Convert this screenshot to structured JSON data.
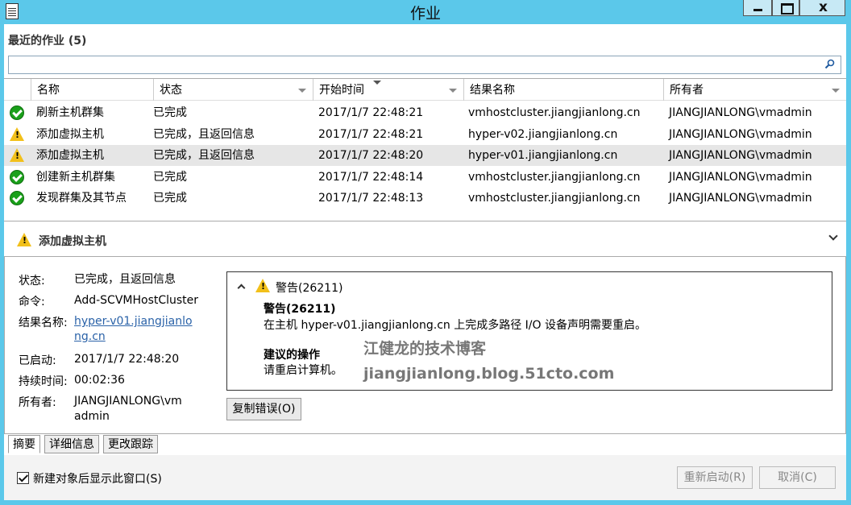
{
  "window": {
    "title": "作业",
    "close_glyph": "x"
  },
  "recent": {
    "title": "最近的作业 (5)",
    "search_placeholder": ""
  },
  "columns": [
    {
      "label": "名称"
    },
    {
      "label": "状态"
    },
    {
      "label": "开始时间"
    },
    {
      "label": "结果名称"
    },
    {
      "label": "所有者"
    }
  ],
  "jobs": [
    {
      "icon": "success-icon",
      "name": "刷新主机群集",
      "status": "已完成",
      "start": "2017/1/7 22:48:21",
      "result": "vmhostcluster.jiangjianlong.cn",
      "owner": "JIANGJIANLONG\\vmadmin"
    },
    {
      "icon": "warning-icon",
      "name": "添加虚拟主机",
      "status": "已完成，且返回信息",
      "start": "2017/1/7 22:48:21",
      "result": "hyper-v02.jiangjianlong.cn",
      "owner": "JIANGJIANLONG\\vmadmin"
    },
    {
      "icon": "warning-icon",
      "name": "添加虚拟主机",
      "status": "已完成，且返回信息",
      "start": "2017/1/7 22:48:20",
      "result": "hyper-v01.jiangjianlong.cn",
      "owner": "JIANGJIANLONG\\vmadmin",
      "selected": true
    },
    {
      "icon": "success-icon",
      "name": "创建新主机群集",
      "status": "已完成",
      "start": "2017/1/7 22:48:14",
      "result": "vmhostcluster.jiangjianlong.cn",
      "owner": "JIANGJIANLONG\\vmadmin"
    },
    {
      "icon": "success-icon",
      "name": "发现群集及其节点",
      "status": "已完成",
      "start": "2017/1/7 22:48:13",
      "result": "vmhostcluster.jiangjianlong.cn",
      "owner": "JIANGJIANLONG\\vmadmin"
    }
  ],
  "detail": {
    "title": "添加虚拟主机",
    "status_label": "状态:",
    "status_value": "已完成，且返回信息",
    "command_label": "命令:",
    "command_value": "Add-SCVMHostCluster",
    "result_label": "结果名称:",
    "result_value": "hyper-v01.jiangjianlong.cn",
    "started_label": "已启动:",
    "started_value": "2017/1/7 22:48:20",
    "duration_label": "持续时间:",
    "duration_value": "00:02:36",
    "owner_label": "所有者:",
    "owner_value": "JIANGJIANLONG\\vmadmin",
    "warning_header": "警告(26211)",
    "warning_title": "警告(26211)",
    "warning_text": "在主机 hyper-v01.jiangjianlong.cn 上完成多路径 I/O 设备声明需要重启。",
    "action_title": "建议的操作",
    "action_text": "请重启计算机。",
    "copy_button": "复制错误(O)",
    "watermark_name": "江健龙的技术博客",
    "watermark_url": "jiangjianlong.blog.51cto.com"
  },
  "tabs": [
    "摘要",
    "详细信息",
    "更改跟踪"
  ],
  "footer": {
    "checkbox_label": "新建对象后显示此窗口(S)",
    "checkbox_checked": true,
    "restart_button": "重新启动(R)",
    "cancel_button": "取消(C)"
  }
}
